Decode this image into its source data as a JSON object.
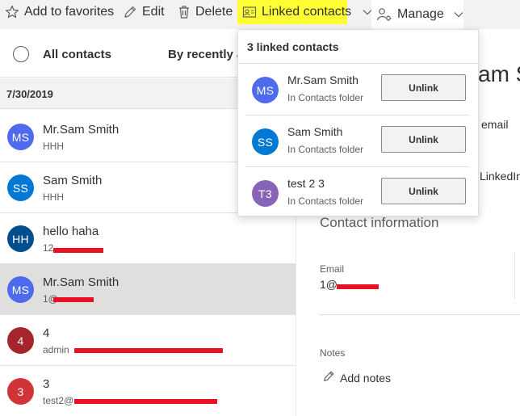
{
  "toolbar": {
    "add_favorites": "Add to favorites",
    "edit": "Edit",
    "delete": "Delete",
    "linked_contacts": "Linked contacts",
    "manage": "Manage",
    "highlight_color": "#ffff33"
  },
  "list": {
    "all_contacts": "All contacts",
    "sort_label": "By recently a",
    "date_group": "7/30/2019",
    "rows": [
      {
        "initials": "MS",
        "name": "Mr.Sam Smith",
        "sub": "HHH",
        "color": "#4f6bed",
        "selected": false
      },
      {
        "initials": "SS",
        "name": "Sam Smith",
        "sub": "HHH",
        "color": "#0078d4",
        "selected": false
      },
      {
        "initials": "HH",
        "name": "hello haha",
        "sub": "12",
        "color": "#004e8c",
        "selected": false
      },
      {
        "initials": "MS",
        "name": "Mr.Sam Smith",
        "sub": "1@",
        "color": "#4f6bed",
        "selected": true
      },
      {
        "initials": "4",
        "name": "4",
        "sub": "admin",
        "color": "#a4262c",
        "selected": false
      },
      {
        "initials": "3",
        "name": "3",
        "sub": "test2@",
        "color": "#d13438",
        "selected": false
      }
    ]
  },
  "detail": {
    "name_peek": "am S",
    "email_peek": "email",
    "linkedin_peek": "LinkedIn",
    "section_title": "Contact information",
    "email_label": "Email",
    "email_value": "1@",
    "notes_label": "Notes",
    "add_notes": "Add notes"
  },
  "popup": {
    "title": "3 linked contacts",
    "items": [
      {
        "initials": "MS",
        "name": "Mr.Sam Smith",
        "sub": "In Contacts folder",
        "color": "#4f6bed",
        "button": "Unlink"
      },
      {
        "initials": "SS",
        "name": "Sam Smith",
        "sub": "In Contacts folder",
        "color": "#0078d4",
        "button": "Unlink"
      },
      {
        "initials": "T3",
        "name": "test 2 3",
        "sub": "In Contacts folder",
        "color": "#8764b8",
        "button": "Unlink"
      }
    ]
  },
  "icons": {
    "favorites": "star-icon",
    "edit": "pencil-icon",
    "delete": "trash-icon",
    "linked": "contact-card-icon",
    "manage": "person-gear-icon",
    "chevron": "chevron-down-icon"
  },
  "redaction_color": "#e81123"
}
